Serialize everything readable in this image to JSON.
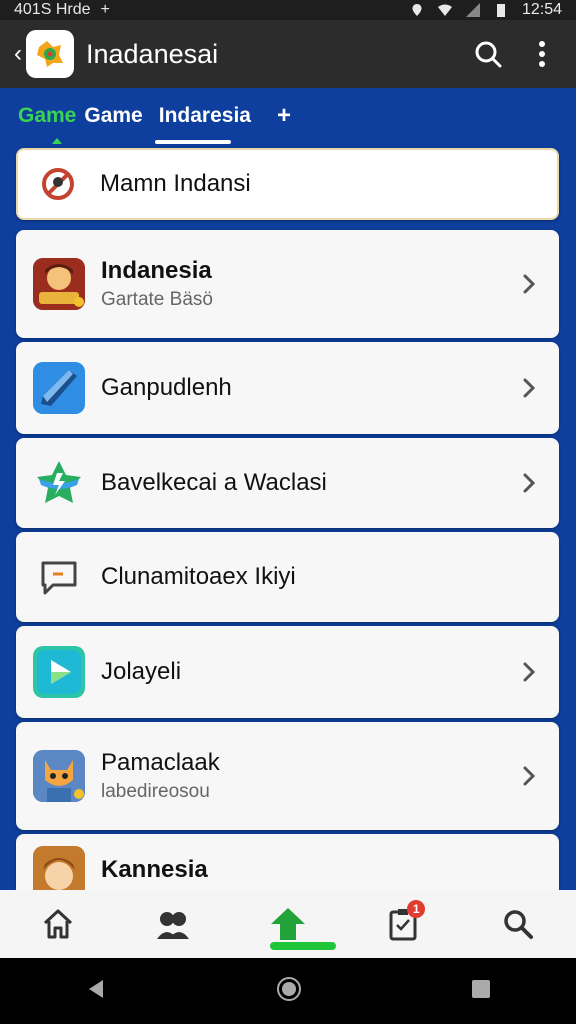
{
  "status_bar": {
    "left_text": "401S Hrde",
    "plus": "+",
    "time": "12:54"
  },
  "app_bar": {
    "title": "Inadanesai",
    "back_icon": "chevron-left-icon",
    "logo_icon": "app-logo-icon",
    "search_icon": "search-icon",
    "more_icon": "more-vert-icon"
  },
  "tabs": {
    "items": [
      {
        "label": "Game"
      },
      {
        "label": "Game"
      },
      {
        "label": "Indaresia"
      }
    ],
    "add_label": "+"
  },
  "list": {
    "search_row": {
      "label": "Mamn Indansi",
      "icon": "no-entry-icon"
    },
    "items": [
      {
        "title": "Indanesia",
        "subtitle": "Gartate Bäsö",
        "icon": "game-character-icon"
      },
      {
        "title": "Ganpudlenh",
        "subtitle": "",
        "icon": "crystal-app-icon"
      },
      {
        "title": "Bavelkecai a Waclasi",
        "subtitle": "",
        "icon": "green-star-icon"
      },
      {
        "title": "Clunamitoaex Ikiyi",
        "subtitle": "",
        "icon": "chat-bubble-icon"
      },
      {
        "title": "Jolayeli",
        "subtitle": "",
        "icon": "play-store-icon"
      },
      {
        "title": "Pamaclaak",
        "subtitle": "labedireosou",
        "icon": "cat-character-icon"
      },
      {
        "title": "Kannesia",
        "subtitle": "",
        "icon": "character-face-icon"
      }
    ]
  },
  "bottom_nav": {
    "items": [
      {
        "icon": "home-icon"
      },
      {
        "icon": "people-icon"
      },
      {
        "icon": "upload-arrow-icon"
      },
      {
        "icon": "clipboard-icon",
        "badge": "1"
      },
      {
        "icon": "search-icon"
      }
    ]
  },
  "colors": {
    "background_blue": "#0f3f9e",
    "accent_green": "#39d353",
    "app_bar": "#2c2c2c"
  }
}
